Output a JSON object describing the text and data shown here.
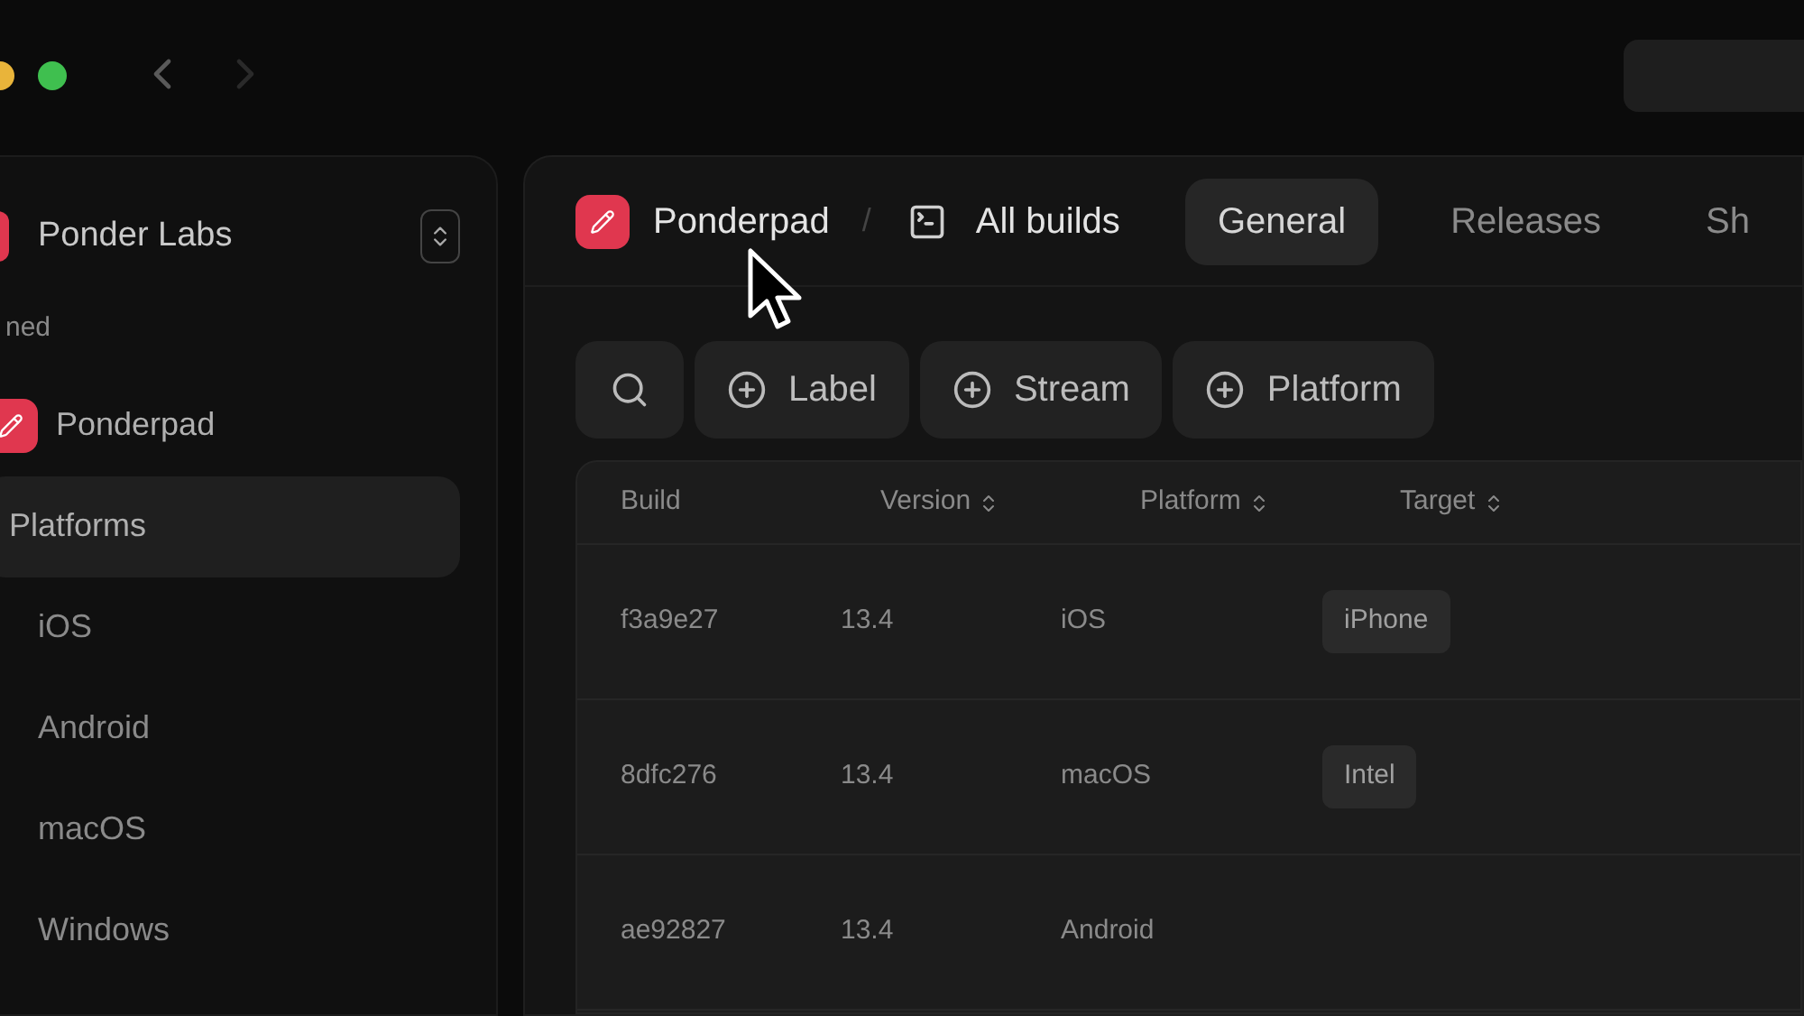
{
  "sidebar": {
    "workspace": "Ponder Labs",
    "section_label": "ned",
    "items": [
      {
        "label": "Ponderpad",
        "kind": "project",
        "selected": false
      },
      {
        "label": "Platforms",
        "kind": "folder",
        "selected": true
      },
      {
        "label": "iOS",
        "kind": "child",
        "selected": false
      },
      {
        "label": "Android",
        "kind": "child",
        "selected": false
      },
      {
        "label": "macOS",
        "kind": "child",
        "selected": false
      },
      {
        "label": "Windows",
        "kind": "child",
        "selected": false
      }
    ]
  },
  "breadcrumb": {
    "project": "Ponderpad",
    "separator": "/",
    "page": "All builds"
  },
  "tabs": [
    {
      "label": "General",
      "selected": true
    },
    {
      "label": "Releases",
      "selected": false
    },
    {
      "label": "Sh",
      "selected": false
    }
  ],
  "filters": [
    "Label",
    "Stream",
    "Platform"
  ],
  "table": {
    "columns": [
      {
        "label": "Build",
        "sortable": false
      },
      {
        "label": "Version",
        "sortable": true
      },
      {
        "label": "Platform",
        "sortable": true
      },
      {
        "label": "Target",
        "sortable": true
      }
    ],
    "rows": [
      {
        "build": "f3a9e27",
        "version": "13.4",
        "platform": "iOS",
        "target": "iPhone"
      },
      {
        "build": "8dfc276",
        "version": "13.4",
        "platform": "macOS",
        "target": "Intel"
      },
      {
        "build": "ae92827",
        "version": "13.4",
        "platform": "Android",
        "target": ""
      }
    ]
  }
}
